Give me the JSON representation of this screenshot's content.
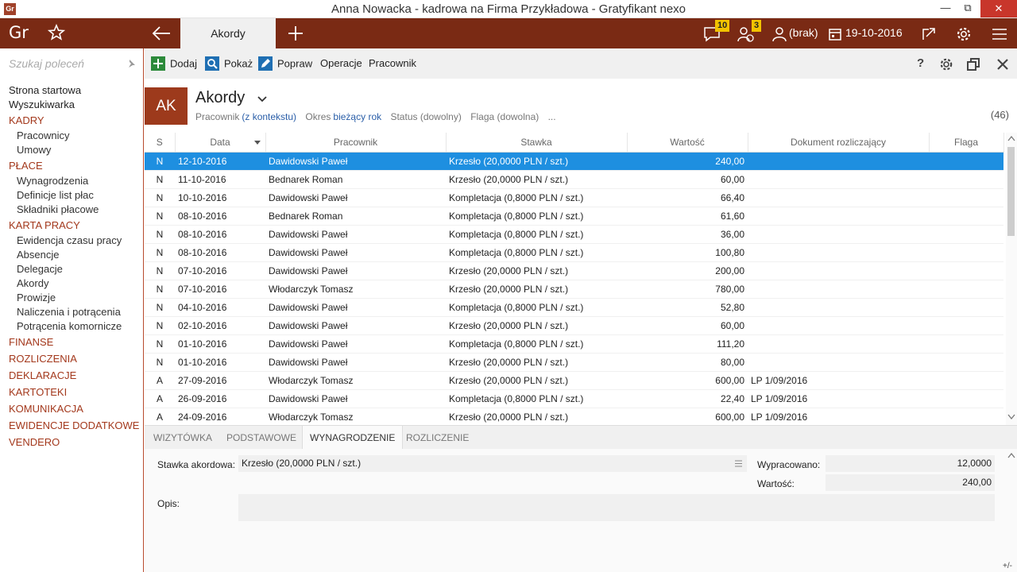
{
  "window": {
    "title": "Anna Nowacka - kadrowa na Firma Przykładowa - Gratyfikant nexo",
    "app_icon": "Gr"
  },
  "topbar": {
    "logo": "Gr",
    "active_tab": "Akordy",
    "messages_badge": "10",
    "tasks_badge": "3",
    "context_user": "(brak)",
    "date": "19-10-2016"
  },
  "sidebar": {
    "search_placeholder": "Szukaj poleceń",
    "items": [
      {
        "label": "Strona startowa",
        "kind": "top"
      },
      {
        "label": "Wyszukiwarka",
        "kind": "top"
      },
      {
        "label": "KADRY",
        "kind": "sec"
      },
      {
        "label": "Pracownicy",
        "kind": "sub"
      },
      {
        "label": "Umowy",
        "kind": "sub"
      },
      {
        "label": "PŁACE",
        "kind": "sec"
      },
      {
        "label": "Wynagrodzenia",
        "kind": "sub"
      },
      {
        "label": "Definicje list płac",
        "kind": "sub"
      },
      {
        "label": "Składniki płacowe",
        "kind": "sub"
      },
      {
        "label": "KARTA PRACY",
        "kind": "sec"
      },
      {
        "label": "Ewidencja czasu pracy",
        "kind": "sub"
      },
      {
        "label": "Absencje",
        "kind": "sub"
      },
      {
        "label": "Delegacje",
        "kind": "sub"
      },
      {
        "label": "Akordy",
        "kind": "sub"
      },
      {
        "label": "Prowizje",
        "kind": "sub"
      },
      {
        "label": "Naliczenia i potrącenia",
        "kind": "sub"
      },
      {
        "label": "Potrącenia komornicze",
        "kind": "sub"
      },
      {
        "label": "FINANSE",
        "kind": "sec"
      },
      {
        "label": "ROZLICZENIA",
        "kind": "sec"
      },
      {
        "label": "DEKLARACJE",
        "kind": "sec"
      },
      {
        "label": "KARTOTEKI",
        "kind": "sec"
      },
      {
        "label": "KOMUNIKACJA",
        "kind": "sec"
      },
      {
        "label": "EWIDENCJE DODATKOWE",
        "kind": "sec"
      },
      {
        "label": "VENDERO",
        "kind": "sec"
      }
    ]
  },
  "toolbar": {
    "add": "Dodaj",
    "show": "Pokaż",
    "edit": "Popraw",
    "operations": "Operacje",
    "employee": "Pracownik",
    "help": "?"
  },
  "header": {
    "badge": "AK",
    "title": "Akordy",
    "filter_employee_label": "Pracownik",
    "filter_employee_value": "(z kontekstu)",
    "filter_period_label": "Okres",
    "filter_period_value": "bieżący rok",
    "filter_status": "Status (dowolny)",
    "filter_flag": "Flaga (dowolna)",
    "filter_more": "...",
    "count": "(46)"
  },
  "grid": {
    "columns": [
      "S",
      "Data",
      "Pracownik",
      "Stawka",
      "Wartość",
      "Dokument rozliczający",
      "Flaga"
    ],
    "rows": [
      [
        "N",
        "12-10-2016",
        "Dawidowski Paweł",
        "Krzesło (20,0000 PLN / szt.)",
        "240,00",
        "",
        ""
      ],
      [
        "N",
        "11-10-2016",
        "Bednarek Roman",
        "Krzesło (20,0000 PLN / szt.)",
        "60,00",
        "",
        ""
      ],
      [
        "N",
        "10-10-2016",
        "Dawidowski Paweł",
        "Kompletacja (0,8000 PLN / szt.)",
        "66,40",
        "",
        ""
      ],
      [
        "N",
        "08-10-2016",
        "Bednarek Roman",
        "Kompletacja (0,8000 PLN / szt.)",
        "61,60",
        "",
        ""
      ],
      [
        "N",
        "08-10-2016",
        "Dawidowski Paweł",
        "Kompletacja (0,8000 PLN / szt.)",
        "36,00",
        "",
        ""
      ],
      [
        "N",
        "08-10-2016",
        "Dawidowski Paweł",
        "Kompletacja (0,8000 PLN / szt.)",
        "100,80",
        "",
        ""
      ],
      [
        "N",
        "07-10-2016",
        "Dawidowski Paweł",
        "Krzesło (20,0000 PLN / szt.)",
        "200,00",
        "",
        ""
      ],
      [
        "N",
        "07-10-2016",
        "Włodarczyk Tomasz",
        "Krzesło (20,0000 PLN / szt.)",
        "780,00",
        "",
        ""
      ],
      [
        "N",
        "04-10-2016",
        "Dawidowski Paweł",
        "Kompletacja (0,8000 PLN / szt.)",
        "52,80",
        "",
        ""
      ],
      [
        "N",
        "02-10-2016",
        "Dawidowski Paweł",
        "Krzesło (20,0000 PLN / szt.)",
        "60,00",
        "",
        ""
      ],
      [
        "N",
        "01-10-2016",
        "Dawidowski Paweł",
        "Kompletacja (0,8000 PLN / szt.)",
        "111,20",
        "",
        ""
      ],
      [
        "N",
        "01-10-2016",
        "Dawidowski Paweł",
        "Krzesło (20,0000 PLN / szt.)",
        "80,00",
        "",
        ""
      ],
      [
        "A",
        "27-09-2016",
        "Włodarczyk Tomasz",
        "Krzesło (20,0000 PLN / szt.)",
        "600,00",
        "LP 1/09/2016",
        ""
      ],
      [
        "A",
        "26-09-2016",
        "Dawidowski Paweł",
        "Kompletacja (0,8000 PLN / szt.)",
        "22,40",
        "LP 1/09/2016",
        ""
      ],
      [
        "A",
        "24-09-2016",
        "Włodarczyk Tomasz",
        "Krzesło (20,0000 PLN / szt.)",
        "600,00",
        "LP 1/09/2016",
        ""
      ]
    ]
  },
  "detail_tabs": [
    "WIZYTÓWKA",
    "PODSTAWOWE",
    "WYNAGRODZENIE",
    "ROZLICZENIE"
  ],
  "detail": {
    "rate_label": "Stawka akordowa:",
    "rate_value": "Krzesło (20,0000 PLN / szt.)",
    "worked_label": "Wypracowano:",
    "worked_value": "12,0000",
    "value_label": "Wartość:",
    "value_value": "240,00",
    "desc_label": "Opis:",
    "desc_value": "",
    "plusminus": "+/-"
  },
  "colors": {
    "brand_bar": "#7a2a14",
    "selection": "#1e8fe0",
    "section": "#a3381c",
    "badge": "#f2c300"
  }
}
